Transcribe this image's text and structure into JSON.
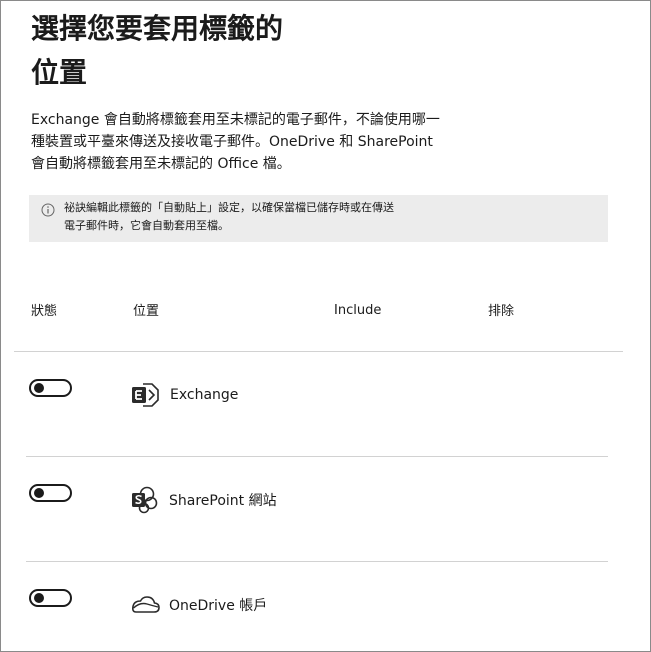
{
  "header": {
    "title": "選擇您要套用標籤的位置"
  },
  "description": "Exchange 會自動將標籤套用至未標記的電子郵件，不論使用哪一種裝置或平臺來傳送及接收電子郵件。OneDrive 和 SharePoint 會自動將標籤套用至未標記的 Office 檔。",
  "info": {
    "icon": "info-icon",
    "text": "祕訣編輯此標籤的「自動貼上」設定，以確保當檔已儲存時或在傳送電子郵件時，它會自動套用至檔。"
  },
  "table": {
    "columns": {
      "status": "狀態",
      "location": "位置",
      "include": "Include",
      "exclude": "排除"
    },
    "rows": [
      {
        "label": "Exchange",
        "icon": "exchange-icon",
        "enabled": false
      },
      {
        "label": "SharePoint 網站",
        "icon": "sharepoint-icon",
        "enabled": false
      },
      {
        "label": "OneDrive 帳戶",
        "icon": "onedrive-icon",
        "enabled": false
      }
    ]
  }
}
